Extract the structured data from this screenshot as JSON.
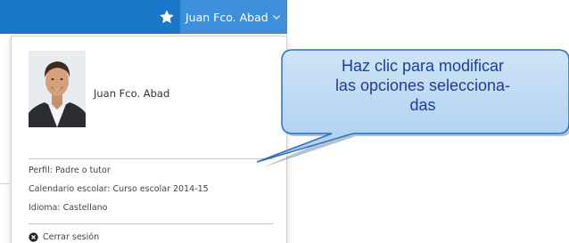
{
  "header": {
    "user_name": "Juan Fco. Abad",
    "favorites_icon": "star-icon",
    "menu_icon": "chevron-down-icon",
    "bar_color": "#1b77c9",
    "toggle_color": "#3d8fd9"
  },
  "profile": {
    "name": "Juan Fco. Abad",
    "avatar_icon": "user-photo"
  },
  "details": {
    "profile_line": "Perfil: Padre o tutor",
    "calendar_line": "Calendario escolar: Curso escolar 2014-15",
    "language_line": "Idioma: Castellano"
  },
  "logout": {
    "label": "Cerrar sesión",
    "icon": "close-circle-icon"
  },
  "callout": {
    "line1": "Haz clic para modificar",
    "line2": "las opciones selecciona-",
    "line3": "das",
    "fill_color": "#b9d8f3",
    "text_color": "#1f3b9e"
  }
}
